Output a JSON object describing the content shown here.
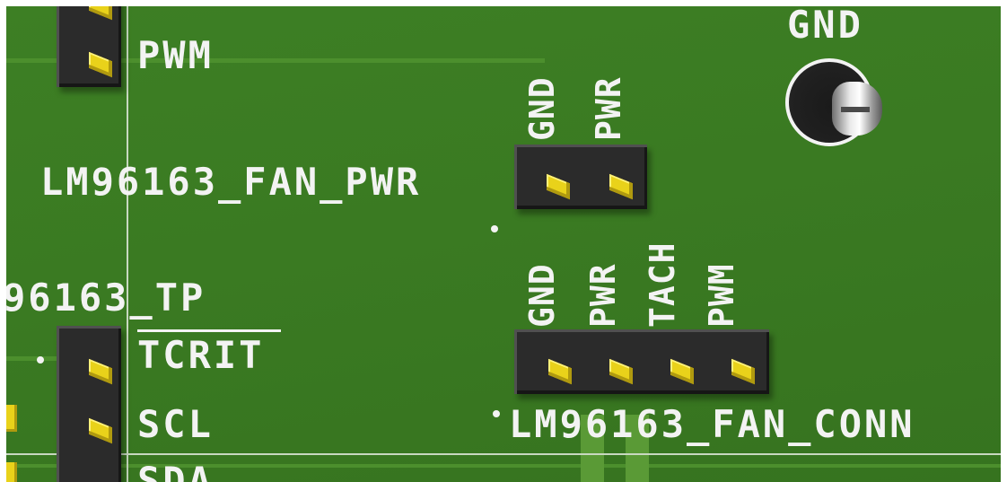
{
  "image": {
    "kind": "pcb-3d-render-crop",
    "colors": {
      "board": "#3a7a22",
      "silkscreen": "#f3f3f3",
      "header_body": "#2b2b2b",
      "pin": "#e9d21a",
      "test_point_pin": "#d8d8d8"
    }
  },
  "labels": {
    "top_left_pin": "PWM",
    "fan_pwr_ref": "LM96163_FAN_PWR",
    "fan_pwr_pins": [
      "GND",
      "PWR"
    ],
    "tp_ref": "96163_TP",
    "tp_pins": [
      "TCRIT",
      "SCL",
      "SDA"
    ],
    "fan_conn_pins": [
      "GND",
      "PWR",
      "TACH",
      "PWM"
    ],
    "fan_conn_ref": "LM96163_FAN_CONN",
    "gnd_tp": "GND"
  }
}
